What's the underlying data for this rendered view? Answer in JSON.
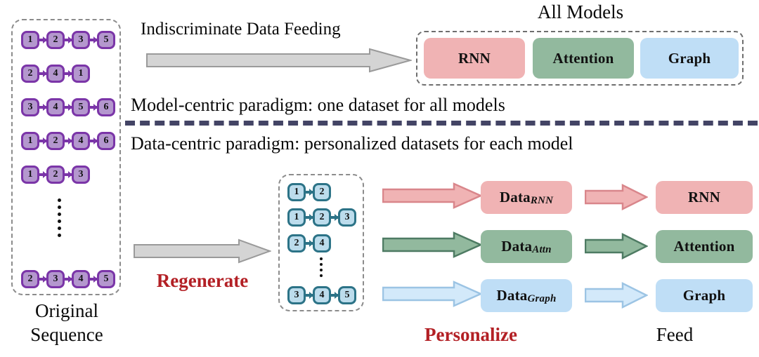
{
  "figure": {
    "title_all_models": "All Models",
    "top_flow_label": "Indiscriminate Data Feeding",
    "paradigm_top": "Model-centric paradigm: one dataset for all models",
    "paradigm_bottom": "Data-centric paradigm: personalized datasets for each model",
    "original_label_line1": "Original",
    "original_label_line2": "Sequence",
    "regenerate_label": "Regenerate",
    "personalize_label": "Personalize",
    "feed_label": "Feed"
  },
  "colors": {
    "node_purple_fill": "#b497ce",
    "node_purple_border": "#7b35a8",
    "node_blue_fill": "#bcdcec",
    "node_blue_border": "#2c7387",
    "rnn": "#f0b3b4",
    "rnn_border": "#d9868b",
    "attention": "#92b99e",
    "attention_border": "#4e7b63",
    "graph": "#bfdef6",
    "graph_border": "#9cc4e4",
    "grey_arrow_fill": "#d4d4d4",
    "grey_arrow_border": "#9a9a9a",
    "divider": "#434465",
    "dashed_border": "#8c8c8c",
    "red_text": "#b32025"
  },
  "original_sequences": {
    "rows": [
      {
        "nodes": [
          "1",
          "2",
          "3",
          "5"
        ]
      },
      {
        "nodes": [
          "2",
          "4",
          "1"
        ]
      },
      {
        "nodes": [
          "3",
          "4",
          "5",
          "6"
        ]
      },
      {
        "nodes": [
          "1",
          "2",
          "4",
          "6"
        ]
      },
      {
        "nodes": [
          "1",
          "2",
          "3"
        ]
      },
      {
        "nodes": [
          "2",
          "3",
          "4",
          "5"
        ]
      }
    ],
    "ellipsis_after_row_index": 4
  },
  "regenerated_sequences": {
    "rows": [
      {
        "nodes": [
          "1",
          "2"
        ]
      },
      {
        "nodes": [
          "1",
          "2",
          "3"
        ]
      },
      {
        "nodes": [
          "2",
          "4"
        ]
      },
      {
        "nodes": [
          "3",
          "4",
          "5"
        ]
      }
    ],
    "ellipsis_after_row_index": 2
  },
  "all_models_box": {
    "items": [
      {
        "label": "RNN",
        "color_key": "rnn"
      },
      {
        "label": "Attention",
        "color_key": "attention"
      },
      {
        "label": "Graph",
        "color_key": "graph"
      }
    ]
  },
  "personalized_rows": [
    {
      "data_label_main": "Data",
      "data_label_sub": "RNN",
      "model_label": "RNN",
      "color_key": "rnn"
    },
    {
      "data_label_main": "Data",
      "data_label_sub": "Attn",
      "model_label": "Attention",
      "color_key": "attention"
    },
    {
      "data_label_main": "Data",
      "data_label_sub": "Graph",
      "model_label": "Graph",
      "color_key": "graph"
    }
  ]
}
